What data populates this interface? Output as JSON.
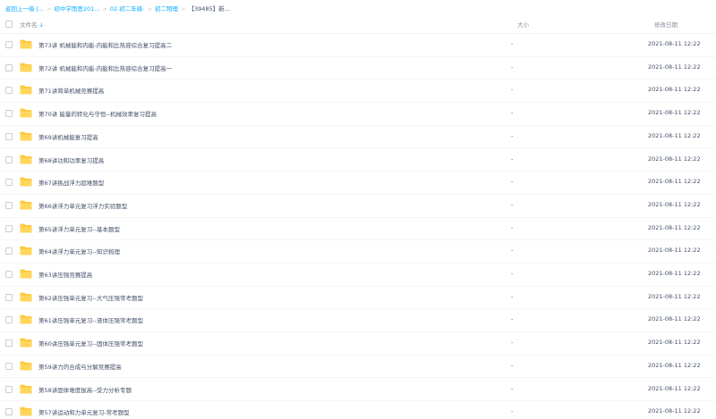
{
  "breadcrumb": {
    "items": [
      "返回上一级",
      "|...",
      "初中学而思201...",
      "02.初二年级-",
      "初二物理",
      "【39485】新..."
    ],
    "separators": [
      ">",
      ">",
      ">",
      ">",
      ">"
    ]
  },
  "header": {
    "name": "文件名",
    "sort_icon": "↓",
    "size": "大小",
    "date": "修改日期"
  },
  "colors": {
    "accent": "#09aaff",
    "folder": "#ffc73a",
    "text": "#424e67"
  },
  "files": [
    {
      "name": "第73讲 机械能和内能-内能和比热容综合复习提高二",
      "size": "-",
      "date": "2021-08-11 12:22"
    },
    {
      "name": "第72讲 机械能和内能-内能和比热容综合复习提高一",
      "size": "-",
      "date": "2021-08-11 12:22"
    },
    {
      "name": "第71讲简单机械竞赛提高",
      "size": "-",
      "date": "2021-08-11 12:22"
    },
    {
      "name": "第70讲 能量的转化与守恒--机械效率复习提高",
      "size": "-",
      "date": "2021-08-11 12:22"
    },
    {
      "name": "第69讲机械能复习提高",
      "size": "-",
      "date": "2021-08-11 12:22"
    },
    {
      "name": "第68讲功和功率复习提高",
      "size": "-",
      "date": "2021-08-11 12:22"
    },
    {
      "name": "第67讲挑战浮力超难题型",
      "size": "-",
      "date": "2021-08-11 12:22"
    },
    {
      "name": "第66讲浮力单元复习浮力实验题型",
      "size": "-",
      "date": "2021-08-11 12:22"
    },
    {
      "name": "第65讲浮力单元复习--基本题型",
      "size": "-",
      "date": "2021-08-11 12:22"
    },
    {
      "name": "第64讲浮力单元复习--知识梳理",
      "size": "-",
      "date": "2021-08-11 12:22"
    },
    {
      "name": "第63讲压强竞赛提高",
      "size": "-",
      "date": "2021-08-11 12:22"
    },
    {
      "name": "第62讲压强单元复习--大气压强常考题型",
      "size": "-",
      "date": "2021-08-11 12:22"
    },
    {
      "name": "第61讲压强单元复习--液体压强常考题型",
      "size": "-",
      "date": "2021-08-11 12:22"
    },
    {
      "name": "第60讲压强单元复习--固体压强常考题型",
      "size": "-",
      "date": "2021-08-11 12:22"
    },
    {
      "name": "第59讲力的合成与分解竞赛提高",
      "size": "-",
      "date": "2021-08-11 12:22"
    },
    {
      "name": "第58讲固体难度拔高--受力分析专题",
      "size": "-",
      "date": "2021-08-11 12:22"
    },
    {
      "name": "第57讲运动和力单元复习-常考题型",
      "size": "-",
      "date": "2021-08-11 12:22"
    }
  ]
}
